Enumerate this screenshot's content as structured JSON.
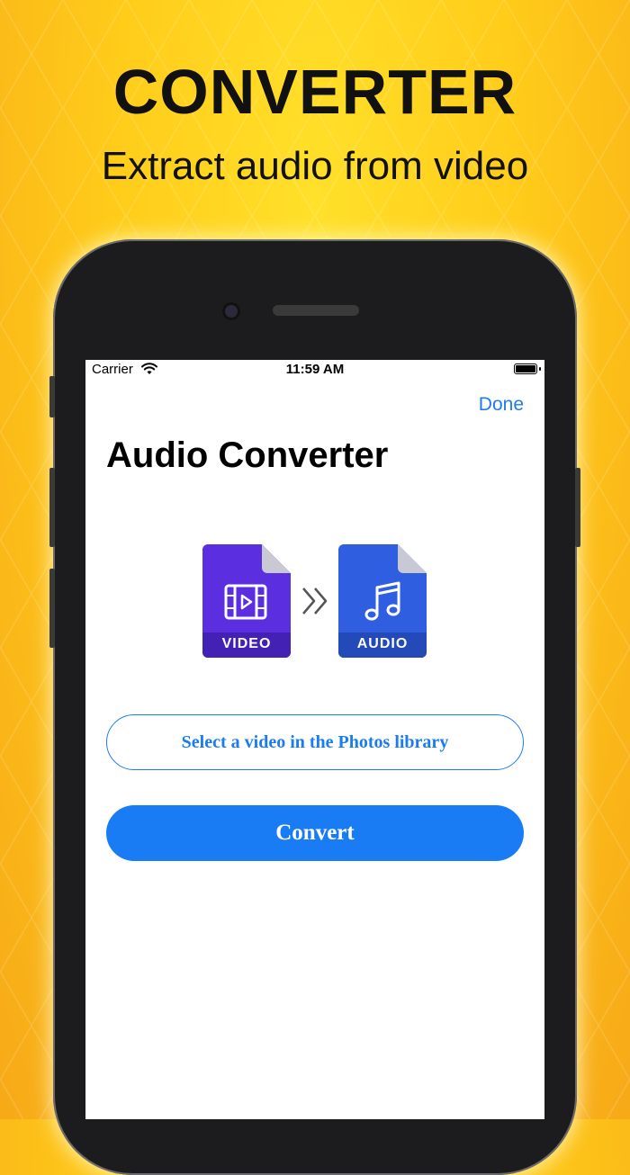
{
  "promo": {
    "headline": "CONVERTER",
    "subheadline": "Extract audio from video"
  },
  "status_bar": {
    "carrier": "Carrier",
    "time": "11:59 AM"
  },
  "nav": {
    "done_label": "Done"
  },
  "screen": {
    "title": "Audio Converter",
    "video_file_label": "VIDEO",
    "audio_file_label": "AUDIO",
    "select_button_label": "Select a video in the Photos library",
    "convert_button_label": "Convert"
  },
  "icons": [
    "wifi-icon",
    "battery-icon",
    "video-file-icon",
    "film-icon",
    "double-chevron-right-icon",
    "audio-file-icon",
    "music-note-icon"
  ],
  "colors": {
    "accent": "#1a7cf5",
    "background": "#ffcc1a",
    "video_file": "#5b2ee0",
    "audio_file": "#2f5fe0"
  }
}
